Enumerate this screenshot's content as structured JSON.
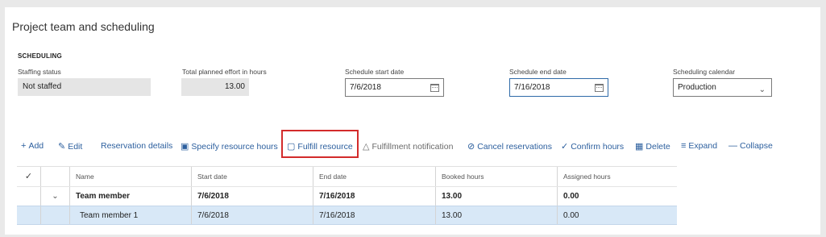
{
  "page": {
    "title": "Project team and scheduling"
  },
  "scheduling": {
    "section_label": "SCHEDULING",
    "staffing_status": {
      "label": "Staffing status",
      "value": "Not staffed"
    },
    "total_effort": {
      "label": "Total planned effort in hours",
      "value": "13.00"
    },
    "start_date": {
      "label": "Schedule start date",
      "value": "7/6/2018"
    },
    "end_date": {
      "label": "Schedule end date",
      "value": "7/16/2018"
    },
    "calendar": {
      "label": "Scheduling calendar",
      "value": "Production"
    }
  },
  "toolbar": {
    "add": "Add",
    "edit": "Edit",
    "reservation_details": "Reservation details",
    "specify_hours": "Specify resource hours",
    "fulfill": "Fulfill resource",
    "fulfillment_notification": "Fulfillment notification",
    "cancel_reservations": "Cancel reservations",
    "confirm_hours": "Confirm hours",
    "delete": "Delete",
    "expand": "Expand",
    "collapse": "Collapse"
  },
  "grid": {
    "columns": [
      "Name",
      "Start date",
      "End date",
      "Booked hours",
      "Assigned hours"
    ],
    "rows": [
      {
        "name": "Team member",
        "start": "7/6/2018",
        "end": "7/16/2018",
        "booked": "13.00",
        "assigned": "0.00"
      },
      {
        "name": "Team member 1",
        "start": "7/6/2018",
        "end": "7/16/2018",
        "booked": "13.00",
        "assigned": "0.00"
      }
    ]
  },
  "colors": {
    "accent": "#2c5f9e",
    "highlight": "#d32b2b",
    "selected_row": "#d8e8f7"
  },
  "icons": [
    "plus-icon",
    "pencil-icon",
    "calendar-icon",
    "clipboard-icon",
    "warning-icon",
    "cancel-icon",
    "check-icon",
    "trash-icon",
    "expand-icon",
    "collapse-icon",
    "chevron-down-icon"
  ]
}
